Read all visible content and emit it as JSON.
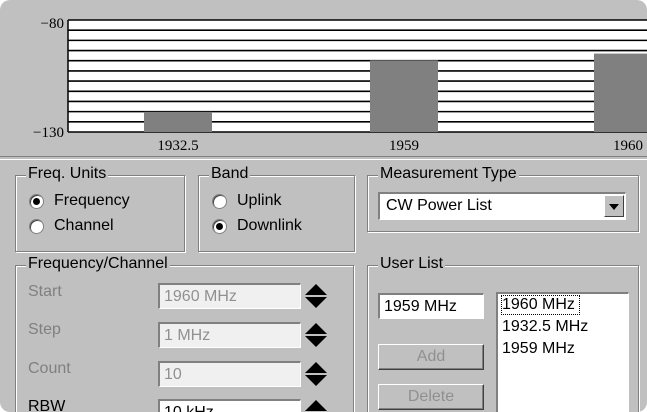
{
  "chart_data": {
    "type": "bar",
    "categories": [
      "1932.5",
      "1959",
      "1960"
    ],
    "values": [
      -121,
      -98,
      -95
    ],
    "ylim": [
      -130,
      -80
    ],
    "yticks": [
      "-80",
      "-130"
    ],
    "grid": true
  },
  "freq_units": {
    "title": "Freq. Units",
    "options": [
      {
        "label": "Frequency",
        "selected": true
      },
      {
        "label": "Channel",
        "selected": false
      }
    ]
  },
  "band": {
    "title": "Band",
    "options": [
      {
        "label": "Uplink",
        "selected": false
      },
      {
        "label": "Downlink",
        "selected": true
      }
    ]
  },
  "measurement_type": {
    "title": "Measurement Type",
    "value": "CW Power List"
  },
  "freq_channel": {
    "title": "Frequency/Channel",
    "start_label": "Start",
    "start_value": "1960 MHz",
    "step_label": "Step",
    "step_value": "1 MHz",
    "count_label": "Count",
    "count_value": "10",
    "rbw_label": "RBW",
    "rbw_value": "10 kHz"
  },
  "user_list": {
    "title": "User List",
    "input_value": "1959 MHz",
    "add_label": "Add",
    "delete_label": "Delete",
    "items": [
      "1960 MHz",
      "1932.5 MHz",
      "1959 MHz"
    ]
  }
}
